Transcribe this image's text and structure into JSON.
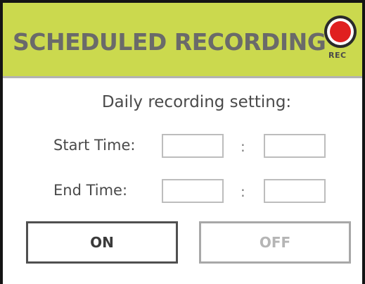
{
  "header": {
    "title": "SCHEDULED RECORDING",
    "rec_label": "REC"
  },
  "main": {
    "subtitle": "Daily recording setting:",
    "start_time": {
      "label": "Start Time:",
      "hours_value": "",
      "separator": ":",
      "minutes_value": ""
    },
    "end_time": {
      "label": "End Time:",
      "hours_value": "",
      "separator": ":",
      "minutes_value": ""
    }
  },
  "buttons": {
    "on_label": "ON",
    "off_label": "OFF"
  },
  "colors": {
    "header_bg": "#cbd94e",
    "title_text": "#6a6a6a",
    "rec_red": "#e02020",
    "on_border": "#505050",
    "off_text": "#b5b5b5"
  }
}
